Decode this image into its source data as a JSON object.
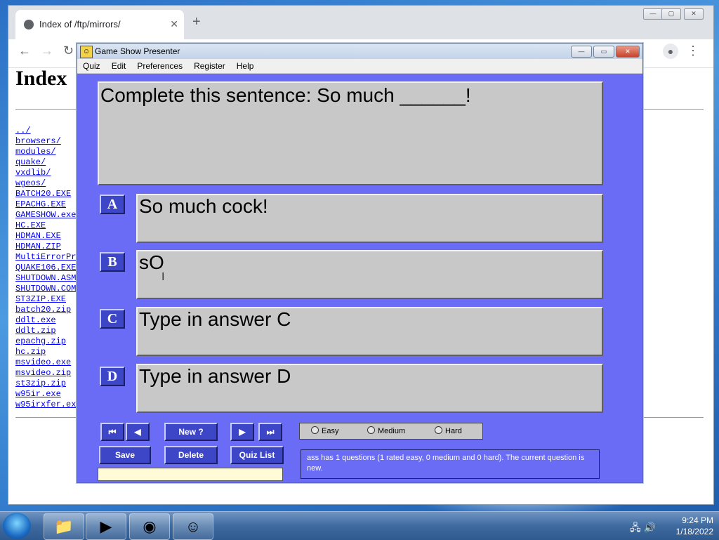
{
  "browser": {
    "tab_title": "Index of /ftp/mirrors/",
    "new_tab": "+",
    "close": "✕",
    "back": "←",
    "forward": "→",
    "reload": "↻",
    "menu": "⋮"
  },
  "page": {
    "heading": "Index",
    "files": [
      "../",
      "browsers/",
      "modules/",
      "quake/",
      "vxdlib/",
      "wgeos/",
      "BATCH20.EXE",
      "EPACHG.EXE",
      "GAMESHOW.exe",
      "HC.EXE",
      "HDMAN.EXE",
      "HDMAN.ZIP",
      "MultiErrorPr",
      "QUAKE106.EXE",
      "SHUTDOWN.ASM",
      "SHUTDOWN.COM",
      "ST3ZIP.EXE",
      "batch20.zip",
      "ddlt.exe",
      "ddlt.zip",
      "epachg.zip",
      "hc.zip",
      "msvideo.exe",
      "msvideo.zip",
      "st3zip.zip",
      "w95ir.exe",
      "w95irxfer.ex"
    ]
  },
  "app": {
    "title": "Game Show Presenter",
    "menu": [
      "Quiz",
      "Edit",
      "Preferences",
      "Register",
      "Help"
    ],
    "question": "Complete this sentence: So much ______!",
    "answers": [
      {
        "letter": "A",
        "text": "So much cock!"
      },
      {
        "letter": "B",
        "text": "sO"
      },
      {
        "letter": "C",
        "text": "Type in answer C"
      },
      {
        "letter": "D",
        "text": "Type in answer D"
      }
    ],
    "buttons": {
      "first": "⏮",
      "prev": "◀",
      "new": "New ?",
      "next": "▶",
      "last": "⏭",
      "save": "Save",
      "delete": "Delete",
      "quiz_list": "Quiz List"
    },
    "difficulty": {
      "easy": "Easy",
      "medium": "Medium",
      "hard": "Hard"
    },
    "status": "ass has 1 questions (1 rated easy, 0 medium and 0 hard). The current question is new."
  },
  "taskbar": {
    "time": "9:24 PM",
    "date": "1/18/2022"
  },
  "colors": {
    "app_bg": "#6a6cf5",
    "button_blue": "#3e46c8",
    "panel_gray": "#c8c8c8"
  }
}
